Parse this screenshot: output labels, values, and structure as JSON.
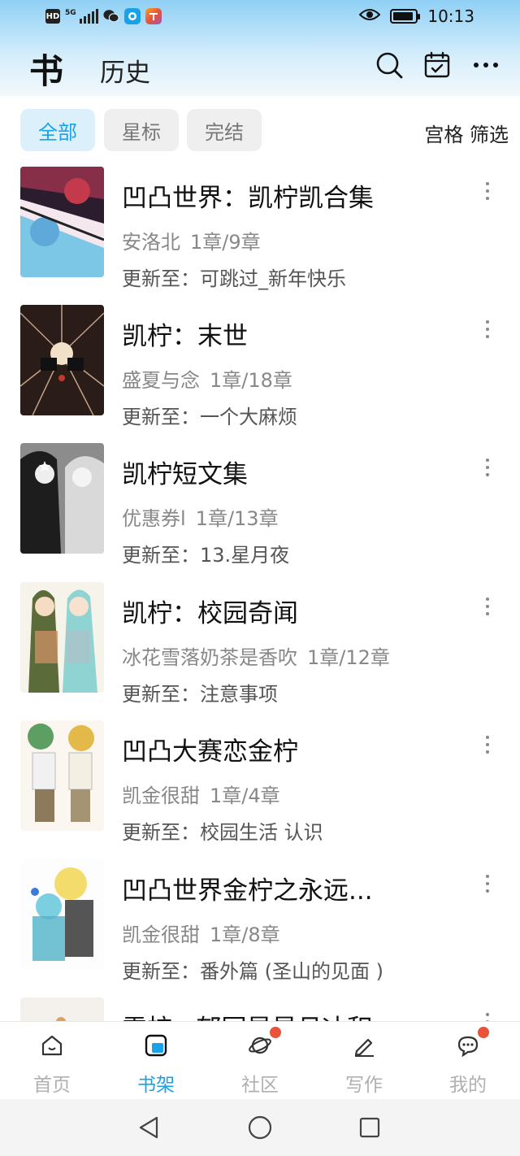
{
  "status_bar": {
    "time": "10:13",
    "hd_label": "HD",
    "network": "5G",
    "battery_level": 0.9
  },
  "header": {
    "title_main": "书",
    "title_history": "历史",
    "icons": [
      "search-icon",
      "calendar-icon",
      "more-icon"
    ]
  },
  "filters": {
    "chips": [
      {
        "label": "全部",
        "active": true
      },
      {
        "label": "星标",
        "active": false
      },
      {
        "label": "完结",
        "active": false
      }
    ],
    "grid_filter": "宫格 筛选"
  },
  "books": [
    {
      "title": "凹凸世界：凯柠凯合集",
      "author": "安洛北",
      "progress": "1章/9章",
      "update": "更新至：可跳过_新年快乐"
    },
    {
      "title": "凯柠：末世",
      "author": "盛夏与念",
      "progress": "1章/18章",
      "update": "更新至：一个大麻烦"
    },
    {
      "title": "凯柠短文集",
      "author": "优惠券l",
      "progress": "1章/13章",
      "update": "更新至：13.星月夜"
    },
    {
      "title": "凯柠：校园奇闻",
      "author": "冰花雪落奶茶是香吹",
      "progress": "1章/12章",
      "update": "更新至：注意事项"
    },
    {
      "title": "凹凸大赛恋金柠",
      "author": "凯金很甜",
      "progress": "1章/4章",
      "update": "更新至：校园生活 认识"
    },
    {
      "title": "凹凸世界金柠之永远...",
      "author": "凯金很甜",
      "progress": "1章/8章",
      "update": "更新至：番外篇 (圣山的见面 )"
    },
    {
      "title": "雷柠 · 郁园星星月冰积",
      "author": "",
      "progress": "",
      "update": ""
    }
  ],
  "tabbar": [
    {
      "label": "首页",
      "active": false,
      "badge": false
    },
    {
      "label": "书架",
      "active": true,
      "badge": false
    },
    {
      "label": "社区",
      "active": false,
      "badge": true
    },
    {
      "label": "写作",
      "active": false,
      "badge": false
    },
    {
      "label": "我的",
      "active": false,
      "badge": true
    }
  ],
  "colors": {
    "accent": "#1aa2e8",
    "badge": "#e8533a",
    "header_gradient_top": "#8fd0f5"
  }
}
